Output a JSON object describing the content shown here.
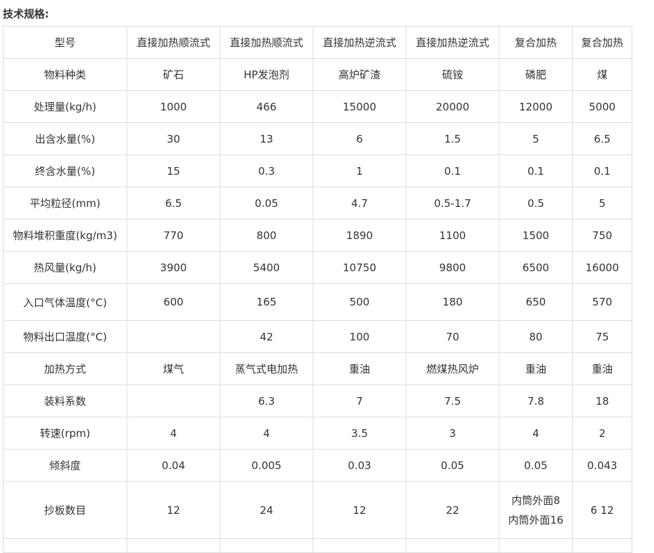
{
  "heading": "技术规格:",
  "columns": [
    "型号",
    "直接加热顺流式",
    "直接加热顺流式",
    "直接加热逆流式",
    "直接加热逆流式",
    "复合加热",
    "复合加热"
  ],
  "rows": [
    {
      "label": "物料种类",
      "values": [
        "矿石",
        "HP发泡剂",
        "高炉矿渣",
        "硫铵",
        "磷肥",
        "煤"
      ]
    },
    {
      "label": "处理量(kg/h)",
      "values": [
        "1000",
        "466",
        "15000",
        "20000",
        "12000",
        "5000"
      ]
    },
    {
      "label": "出含水量(%)",
      "values": [
        "30",
        "13",
        "6",
        "1.5",
        "5",
        "6.5"
      ]
    },
    {
      "label": "终含水量(%)",
      "values": [
        "15",
        "0.3",
        "1",
        "0.1",
        "0.1",
        "0.1"
      ]
    },
    {
      "label": "平均粒径(mm)",
      "values": [
        "6.5",
        "0.05",
        "4.7",
        "0.5-1.7",
        "0.5",
        "5"
      ]
    },
    {
      "label": "物料堆积重度(kg/m3)",
      "values": [
        "770",
        "800",
        "1890",
        "1100",
        "1500",
        "750"
      ]
    },
    {
      "label": "热风量(kg/h)",
      "values": [
        "3900",
        "5400",
        "10750",
        "9800",
        "6500",
        "16000"
      ]
    },
    {
      "label": "入口气体温度(°C)",
      "values": [
        "600",
        "165",
        "500",
        "180",
        "650",
        "570"
      ]
    },
    {
      "label": "物料出口温度(°C)",
      "values": [
        "",
        "42",
        "100",
        "70",
        "80",
        "75"
      ]
    },
    {
      "label": "加热方式",
      "values": [
        "煤气",
        "蒸气式电加热",
        "重油",
        "燃煤热风炉",
        "重油",
        "重油"
      ]
    },
    {
      "label": "装料系数",
      "values": [
        "",
        "6.3",
        "7",
        "7.5",
        "7.8",
        "18"
      ]
    },
    {
      "label": "转速(rpm)",
      "values": [
        "4",
        "4",
        "3.5",
        "3",
        "4",
        "2"
      ]
    },
    {
      "label": "倾斜度",
      "values": [
        "0.04",
        "0.005",
        "0.03",
        "0.05",
        "0.05",
        "0.043"
      ]
    },
    {
      "label": "抄板数目",
      "values": [
        "12",
        "24",
        "12",
        "22",
        [
          "内筒外面8",
          "内筒外面16"
        ],
        "6 12"
      ]
    }
  ]
}
